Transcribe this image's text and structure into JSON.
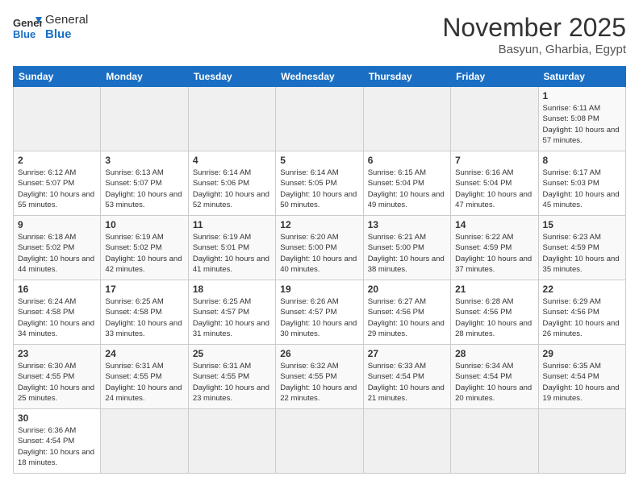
{
  "header": {
    "logo_general": "General",
    "logo_blue": "Blue",
    "month_title": "November 2025",
    "location": "Basyun, Gharbia, Egypt"
  },
  "weekdays": [
    "Sunday",
    "Monday",
    "Tuesday",
    "Wednesday",
    "Thursday",
    "Friday",
    "Saturday"
  ],
  "weeks": [
    [
      {
        "day": "",
        "info": ""
      },
      {
        "day": "",
        "info": ""
      },
      {
        "day": "",
        "info": ""
      },
      {
        "day": "",
        "info": ""
      },
      {
        "day": "",
        "info": ""
      },
      {
        "day": "",
        "info": ""
      },
      {
        "day": "1",
        "info": "Sunrise: 6:11 AM\nSunset: 5:08 PM\nDaylight: 10 hours and 57 minutes."
      }
    ],
    [
      {
        "day": "2",
        "info": "Sunrise: 6:12 AM\nSunset: 5:07 PM\nDaylight: 10 hours and 55 minutes."
      },
      {
        "day": "3",
        "info": "Sunrise: 6:13 AM\nSunset: 5:07 PM\nDaylight: 10 hours and 53 minutes."
      },
      {
        "day": "4",
        "info": "Sunrise: 6:14 AM\nSunset: 5:06 PM\nDaylight: 10 hours and 52 minutes."
      },
      {
        "day": "5",
        "info": "Sunrise: 6:14 AM\nSunset: 5:05 PM\nDaylight: 10 hours and 50 minutes."
      },
      {
        "day": "6",
        "info": "Sunrise: 6:15 AM\nSunset: 5:04 PM\nDaylight: 10 hours and 49 minutes."
      },
      {
        "day": "7",
        "info": "Sunrise: 6:16 AM\nSunset: 5:04 PM\nDaylight: 10 hours and 47 minutes."
      },
      {
        "day": "8",
        "info": "Sunrise: 6:17 AM\nSunset: 5:03 PM\nDaylight: 10 hours and 45 minutes."
      }
    ],
    [
      {
        "day": "9",
        "info": "Sunrise: 6:18 AM\nSunset: 5:02 PM\nDaylight: 10 hours and 44 minutes."
      },
      {
        "day": "10",
        "info": "Sunrise: 6:19 AM\nSunset: 5:02 PM\nDaylight: 10 hours and 42 minutes."
      },
      {
        "day": "11",
        "info": "Sunrise: 6:19 AM\nSunset: 5:01 PM\nDaylight: 10 hours and 41 minutes."
      },
      {
        "day": "12",
        "info": "Sunrise: 6:20 AM\nSunset: 5:00 PM\nDaylight: 10 hours and 40 minutes."
      },
      {
        "day": "13",
        "info": "Sunrise: 6:21 AM\nSunset: 5:00 PM\nDaylight: 10 hours and 38 minutes."
      },
      {
        "day": "14",
        "info": "Sunrise: 6:22 AM\nSunset: 4:59 PM\nDaylight: 10 hours and 37 minutes."
      },
      {
        "day": "15",
        "info": "Sunrise: 6:23 AM\nSunset: 4:59 PM\nDaylight: 10 hours and 35 minutes."
      }
    ],
    [
      {
        "day": "16",
        "info": "Sunrise: 6:24 AM\nSunset: 4:58 PM\nDaylight: 10 hours and 34 minutes."
      },
      {
        "day": "17",
        "info": "Sunrise: 6:25 AM\nSunset: 4:58 PM\nDaylight: 10 hours and 33 minutes."
      },
      {
        "day": "18",
        "info": "Sunrise: 6:25 AM\nSunset: 4:57 PM\nDaylight: 10 hours and 31 minutes."
      },
      {
        "day": "19",
        "info": "Sunrise: 6:26 AM\nSunset: 4:57 PM\nDaylight: 10 hours and 30 minutes."
      },
      {
        "day": "20",
        "info": "Sunrise: 6:27 AM\nSunset: 4:56 PM\nDaylight: 10 hours and 29 minutes."
      },
      {
        "day": "21",
        "info": "Sunrise: 6:28 AM\nSunset: 4:56 PM\nDaylight: 10 hours and 28 minutes."
      },
      {
        "day": "22",
        "info": "Sunrise: 6:29 AM\nSunset: 4:56 PM\nDaylight: 10 hours and 26 minutes."
      }
    ],
    [
      {
        "day": "23",
        "info": "Sunrise: 6:30 AM\nSunset: 4:55 PM\nDaylight: 10 hours and 25 minutes."
      },
      {
        "day": "24",
        "info": "Sunrise: 6:31 AM\nSunset: 4:55 PM\nDaylight: 10 hours and 24 minutes."
      },
      {
        "day": "25",
        "info": "Sunrise: 6:31 AM\nSunset: 4:55 PM\nDaylight: 10 hours and 23 minutes."
      },
      {
        "day": "26",
        "info": "Sunrise: 6:32 AM\nSunset: 4:55 PM\nDaylight: 10 hours and 22 minutes."
      },
      {
        "day": "27",
        "info": "Sunrise: 6:33 AM\nSunset: 4:54 PM\nDaylight: 10 hours and 21 minutes."
      },
      {
        "day": "28",
        "info": "Sunrise: 6:34 AM\nSunset: 4:54 PM\nDaylight: 10 hours and 20 minutes."
      },
      {
        "day": "29",
        "info": "Sunrise: 6:35 AM\nSunset: 4:54 PM\nDaylight: 10 hours and 19 minutes."
      }
    ],
    [
      {
        "day": "30",
        "info": "Sunrise: 6:36 AM\nSunset: 4:54 PM\nDaylight: 10 hours and 18 minutes."
      },
      {
        "day": "",
        "info": ""
      },
      {
        "day": "",
        "info": ""
      },
      {
        "day": "",
        "info": ""
      },
      {
        "day": "",
        "info": ""
      },
      {
        "day": "",
        "info": ""
      },
      {
        "day": "",
        "info": ""
      }
    ]
  ]
}
